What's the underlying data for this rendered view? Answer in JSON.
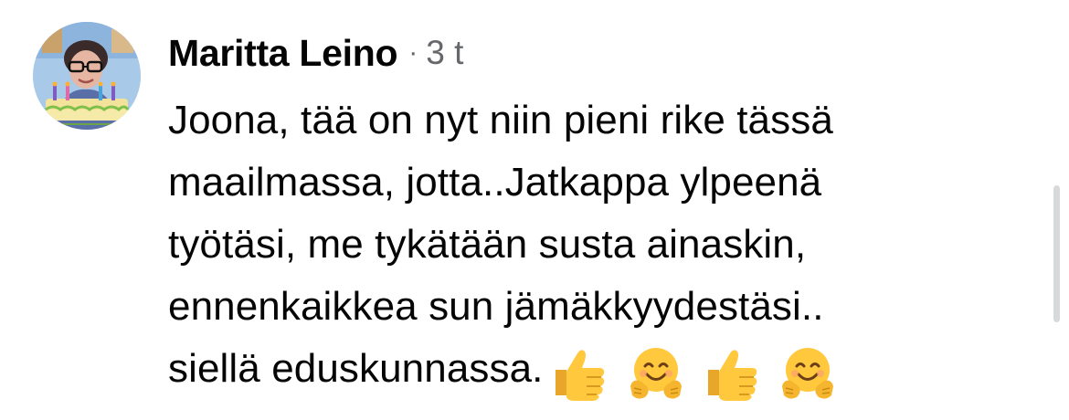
{
  "comment": {
    "author": "Maritta Leino",
    "separator": "·",
    "timestamp": "3 t",
    "text_lines": [
      "Joona, tää on nyt niin pieni rike tässä",
      "maailmassa, jotta..Jatkappa ylpeenä",
      "työtäsi, me tykätään susta ainaskin,",
      "ennenkaikkea sun jämäkkyydestäsi..",
      "siellä eduskunnassa."
    ],
    "emojis": [
      "thumbs-up-icon",
      "hugging-face-icon",
      "thumbs-up-icon",
      "hugging-face-icon"
    ]
  },
  "colors": {
    "text": "#050505",
    "secondary_text": "#65676b",
    "emoji_yellow": "#ffc83d",
    "scrollbar": "#d8d9db"
  }
}
